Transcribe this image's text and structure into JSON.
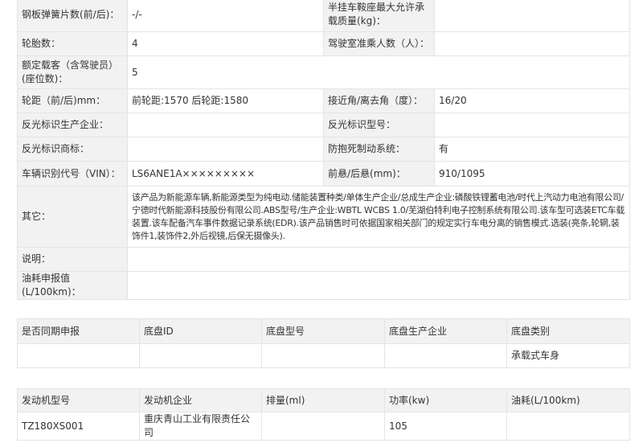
{
  "spec": {
    "rows": [
      {
        "l1": "钢板弹簧片数(前/后)：",
        "v1": "-/-",
        "l2": "半挂车鞍座最大允许承载质量(kg)：",
        "v2": ""
      },
      {
        "l1": "轮胎数：",
        "v1": "4",
        "l2": "驾驶室准乘人数（人）：",
        "v2": ""
      },
      {
        "l1": "额定载客（含驾驶员）(座位数)：",
        "v1": "5"
      },
      {
        "l1": "轮距（前/后)mm：",
        "v1": "前轮距:1570 后轮距:1580",
        "l2": "接近角/离去角（度）：",
        "v2": "16/20"
      },
      {
        "l1": "反光标识生产企业：",
        "v1": "",
        "l2": "反光标识型号：",
        "v2": ""
      },
      {
        "l1": "反光标识商标：",
        "v1": "",
        "l2": "防抱死制动系统：",
        "v2": "有"
      },
      {
        "l1": "车辆识别代号（VIN）：",
        "v1": "LS6ANE1A×××××××××",
        "l2": "前悬/后悬(mm)：",
        "v2": "910/1095"
      },
      {
        "l1": "其它：",
        "v1": "该产品为新能源车辆,新能源类型为纯电动.储能装置种类/单体生产企业/总成生产企业:磷酸铁锂蓄电池/时代上汽动力电池有限公司/宁德时代新能源科技股份有限公司.ABS型号/生产企业:WBTL WCBS 1.0/芜湖伯特利电子控制系统有限公司.该车型可选装ETC车载装置.该车配备汽车事件数据记录系统(EDR).该产品销售时可依据国家相关部门的规定实行车电分离的销售模式.选装(亮条,轮辋,装饰件1,装饰件2,外后视镜,后保无摄像头)."
      },
      {
        "l1": "说明：",
        "v1": ""
      },
      {
        "l1": "油耗申报值(L/100km)：",
        "v1": ""
      }
    ]
  },
  "chassis": {
    "headers": [
      "是否同期申报",
      "底盘ID",
      "底盘型号",
      "底盘生产企业",
      "底盘类别"
    ],
    "row": [
      "",
      "",
      "",
      "",
      "承载式车身"
    ]
  },
  "engine": {
    "headers": [
      "发动机型号",
      "发动机企业",
      "排量(ml)",
      "功率(kw)",
      "油耗(L/100km)"
    ],
    "row": [
      "TZ180XS001",
      "重庆青山工业有限责任公司",
      "",
      "105",
      ""
    ]
  }
}
